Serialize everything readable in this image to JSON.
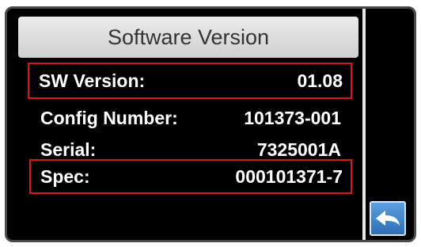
{
  "screen": {
    "title": "Software Version"
  },
  "info": {
    "sw_version_label": "SW Version:",
    "sw_version_value": "01.08",
    "config_number_label": "Config Number:",
    "config_number_value": "101373-001",
    "serial_label": "Serial:",
    "serial_value": "7325001A",
    "spec_label": "Spec:",
    "spec_value": "000101371-7"
  },
  "controls": {
    "back_icon": "back-arrow-icon"
  },
  "colors": {
    "background": "#000000",
    "title_bar": "#dcdcdc",
    "highlight_border": "#e01616",
    "back_button": "#3f82c8"
  }
}
